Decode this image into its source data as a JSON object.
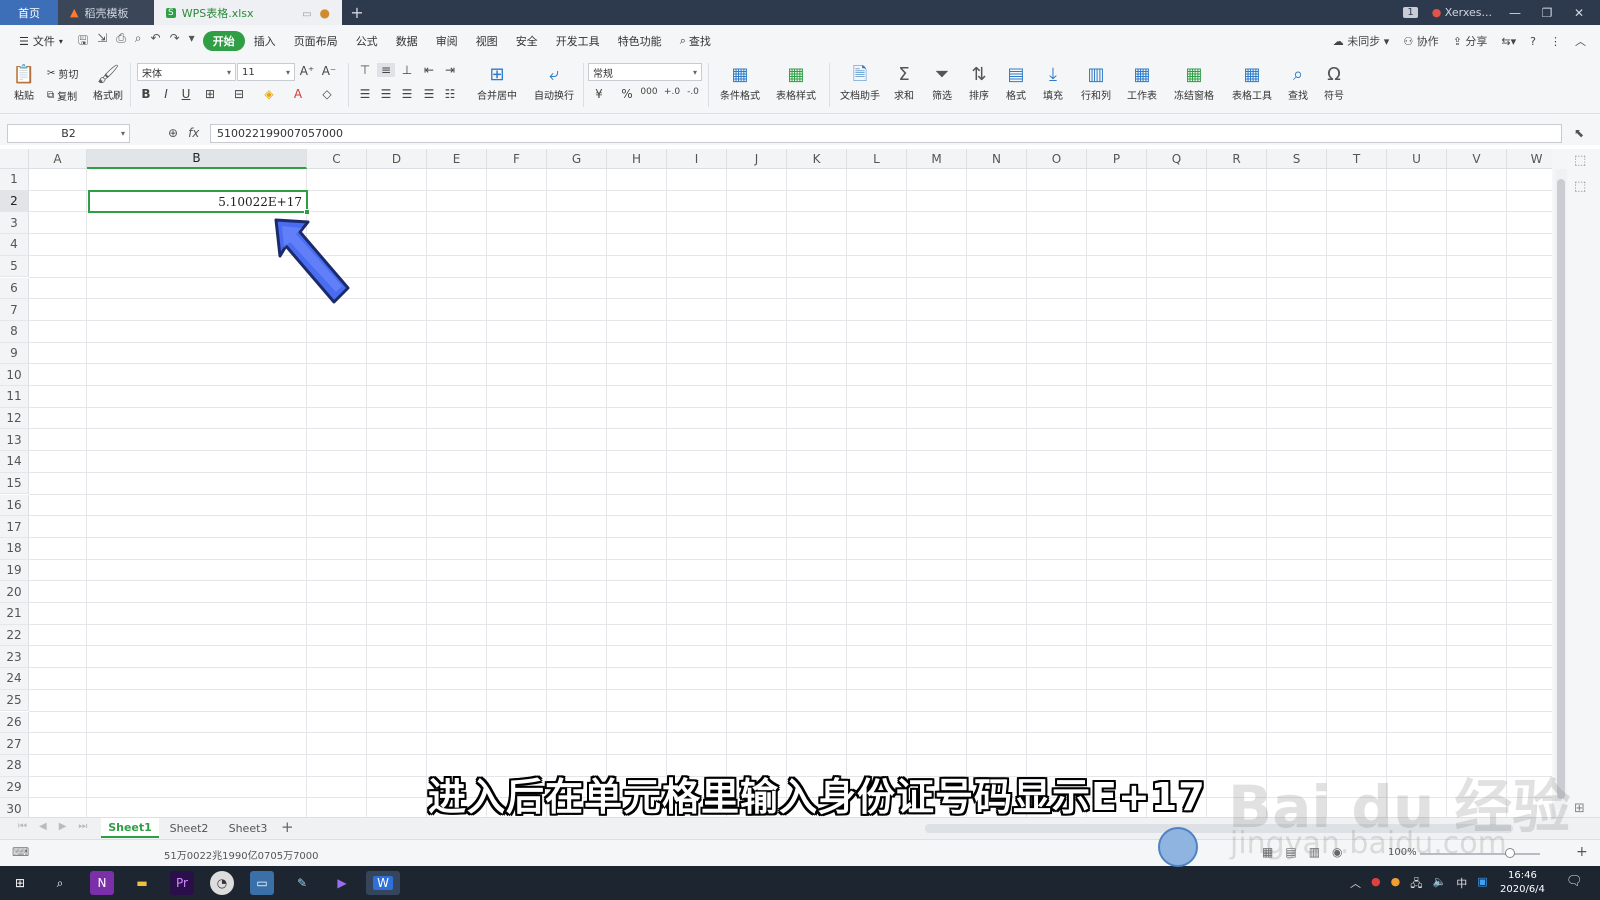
{
  "titlebar": {
    "tabs": [
      {
        "label": "首页"
      },
      {
        "label": "稻壳模板"
      },
      {
        "label": "WPS表格.xlsx"
      }
    ],
    "plus": "+",
    "window_badge": "1",
    "user": "Xerxes..."
  },
  "menu": {
    "file": "文件",
    "items": [
      "开始",
      "插入",
      "页面布局",
      "公式",
      "数据",
      "审阅",
      "视图",
      "安全",
      "开发工具",
      "特色功能"
    ],
    "search": "查找",
    "right": [
      "未同步",
      "协作",
      "分享"
    ]
  },
  "ribbon": {
    "paste": "粘贴",
    "cut": "剪切",
    "copy": "复制",
    "format_painter": "格式刷",
    "font_name": "宋体",
    "font_size": "11",
    "merge": "合并居中",
    "wrap": "自动换行",
    "number_format": "常规",
    "cond_format": "条件格式",
    "table_style": "表格样式",
    "doc_helper": "文档助手",
    "sum": "求和",
    "filter": "筛选",
    "sort": "排序",
    "format": "格式",
    "fill": "填充",
    "row_col": "行和列",
    "worksheet": "工作表",
    "freeze": "冻结窗格",
    "table_tools": "表格工具",
    "find": "查找",
    "symbol": "符号"
  },
  "formula_bar": {
    "name_box": "B2",
    "fx": "fx",
    "value": "510022199007057000"
  },
  "grid": {
    "columns": [
      "A",
      "B",
      "C",
      "D",
      "E",
      "F",
      "G",
      "H",
      "I",
      "J",
      "K",
      "L",
      "M",
      "N",
      "O",
      "P",
      "Q",
      "R",
      "S",
      "T",
      "U",
      "V",
      "W"
    ],
    "rows": [
      "1",
      "2",
      "3",
      "4",
      "5",
      "6",
      "7",
      "8",
      "9",
      "10",
      "11",
      "12",
      "13",
      "14",
      "15",
      "16",
      "17",
      "18",
      "19",
      "20",
      "21",
      "22",
      "23",
      "24",
      "25",
      "26",
      "27",
      "28",
      "29",
      "30"
    ],
    "selected_column": "B",
    "selected_row": "2",
    "active_cell_value": "5.10022E+17"
  },
  "sheets": {
    "tabs": [
      "Sheet1",
      "Sheet2",
      "Sheet3"
    ],
    "active": "Sheet1"
  },
  "status": {
    "text": "51万0022兆1990亿0705万7000",
    "zoom": "100%"
  },
  "taskbar": {
    "time": "16:46",
    "date": "2020/6/4",
    "ime": "中"
  },
  "overlay": {
    "caption": "进入后在单元格里输入身份证号码显示E+17",
    "watermark": "Bai du 经验",
    "watermark_url": "jingyan.baidu.com"
  },
  "colors": {
    "accent": "#2f9e44",
    "titlebar": "#2d3a4d",
    "arrow": "#4a6cf0"
  }
}
